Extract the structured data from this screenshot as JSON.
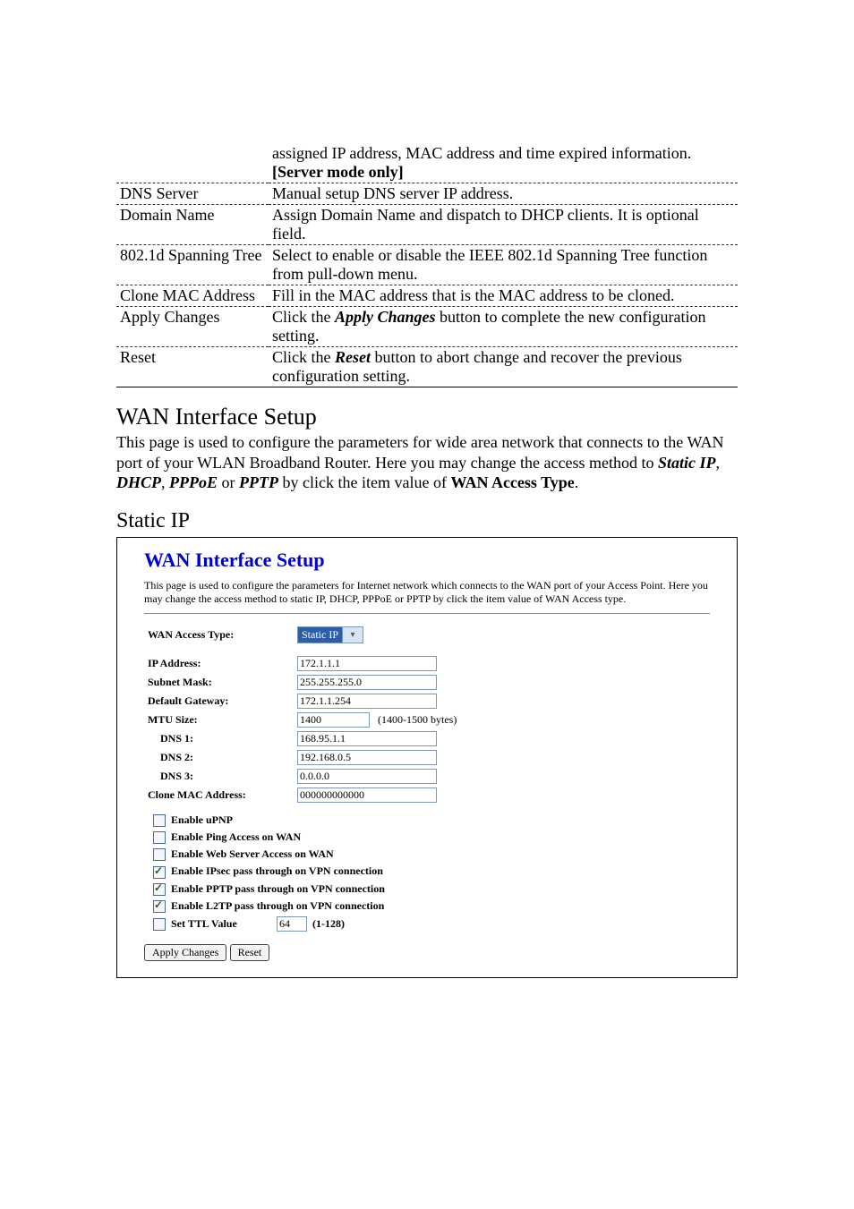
{
  "defs": [
    {
      "label": "",
      "text_pre": "assigned IP address, MAC address and time expired information. ",
      "bold": "[Server mode only]",
      "text_post": "",
      "border": "dashed"
    },
    {
      "label": "DNS Server",
      "text_pre": "Manual setup DNS server IP address.",
      "bold": "",
      "text_post": "",
      "border": "dashed"
    },
    {
      "label": "Domain Name",
      "text_pre": "Assign Domain Name and dispatch to DHCP clients. It is optional field.",
      "bold": "",
      "text_post": "",
      "border": "dashed"
    },
    {
      "label": "802.1d Spanning Tree",
      "text_pre": "Select to enable or disable the IEEE 802.1d Spanning Tree function from pull-down menu.",
      "bold": "",
      "text_post": "",
      "border": "dashed"
    },
    {
      "label": "Clone MAC Address",
      "text_pre": "Fill in the MAC address that is the MAC address to be cloned.",
      "bold": "",
      "text_post": "",
      "border": "dashed"
    },
    {
      "label": "Apply Changes",
      "text_pre": "Click the ",
      "bolditalic": "Apply Changes",
      "text_post": " button to complete the new configuration setting.",
      "border": "dashed"
    },
    {
      "label": "Reset",
      "text_pre": "Click the ",
      "bolditalic": "Reset",
      "text_post": " button to abort change and recover the previous configuration setting.",
      "border": "solid"
    }
  ],
  "section_heading": "WAN Interface Setup",
  "section_intro_pre": "This page is used to configure the parameters for wide area network that connects to the WAN port of your WLAN Broadband Router. Here you may change the access method to ",
  "section_intro_items": [
    "Static IP",
    "DHCP",
    "PPPoE",
    "PPTP"
  ],
  "section_intro_mid": " by click the item value of ",
  "section_intro_tail": "WAN Access Type",
  "subhead": "Static IP",
  "panel": {
    "title": "WAN Interface Setup",
    "desc": "This page is used to configure the parameters for Internet network which connects to the WAN port of your Access Point. Here you may change the access method to static IP, DHCP, PPPoE or PPTP by click the item value of WAN Access type.",
    "rows": {
      "wan_access_label": "WAN Access Type:",
      "wan_access_value": "Static IP",
      "ip_label": "IP Address:",
      "ip_value": "172.1.1.1",
      "subnet_label": "Subnet Mask:",
      "subnet_value": "255.255.255.0",
      "gw_label": "Default Gateway:",
      "gw_value": "172.1.1.254",
      "mtu_label": "MTU Size:",
      "mtu_value": "1400",
      "mtu_note": "(1400-1500 bytes)",
      "dns1_label": "DNS 1:",
      "dns1_value": "168.95.1.1",
      "dns2_label": "DNS 2:",
      "dns2_value": "192.168.0.5",
      "dns3_label": "DNS 3:",
      "dns3_value": "0.0.0.0",
      "clone_label": "Clone MAC Address:",
      "clone_value": "000000000000"
    },
    "options": [
      {
        "checked": false,
        "label": "Enable uPNP"
      },
      {
        "checked": false,
        "label": "Enable Ping Access on WAN"
      },
      {
        "checked": false,
        "label": "Enable Web Server Access on WAN"
      },
      {
        "checked": true,
        "label": "Enable IPsec pass through on VPN connection"
      },
      {
        "checked": true,
        "label": "Enable PPTP pass through on VPN connection"
      },
      {
        "checked": true,
        "label": "Enable L2TP pass through on VPN connection"
      }
    ],
    "ttl": {
      "checked": false,
      "label": "Set TTL Value",
      "value": "64",
      "note": "(1-128)"
    },
    "buttons": {
      "apply": "Apply Changes",
      "reset": "Reset"
    }
  }
}
